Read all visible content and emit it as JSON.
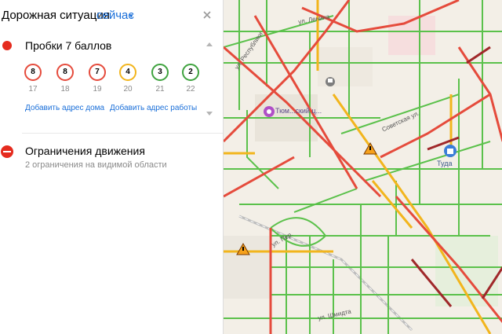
{
  "header": {
    "title": "Дорожная ситуация",
    "now_label": "сейчас",
    "caret": "▾"
  },
  "traffic": {
    "title": "Пробки 7 баллов",
    "forecast": [
      {
        "score": "8",
        "hour": "17",
        "color": "#e54b3c"
      },
      {
        "score": "8",
        "hour": "18",
        "color": "#e54b3c"
      },
      {
        "score": "7",
        "hour": "19",
        "color": "#e54b3c"
      },
      {
        "score": "4",
        "hour": "20",
        "color": "#f2b51d"
      },
      {
        "score": "3",
        "hour": "21",
        "color": "#3fa33f"
      },
      {
        "score": "2",
        "hour": "22",
        "color": "#3fa33f"
      }
    ],
    "add_home": "Добавить адрес дома",
    "add_work": "Добавить адрес работы"
  },
  "restrictions": {
    "title": "Ограничения движения",
    "subtitle": "2 ограничения на видимой области"
  },
  "map": {
    "poi_mall": "Тюм...ский ц...",
    "poi_shop": "Туда",
    "streets": [
      "ул. Республики",
      "Советская ул.",
      "ул. Шмидта",
      "ул. Ленина",
      "ул. Пер."
    ]
  },
  "colors": {
    "jam_red": "#e54b3c",
    "jam_dark": "#a0282a",
    "slow_yellow": "#f2b51d",
    "free_green": "#5bc14b",
    "link_blue": "#1a6fd9"
  }
}
